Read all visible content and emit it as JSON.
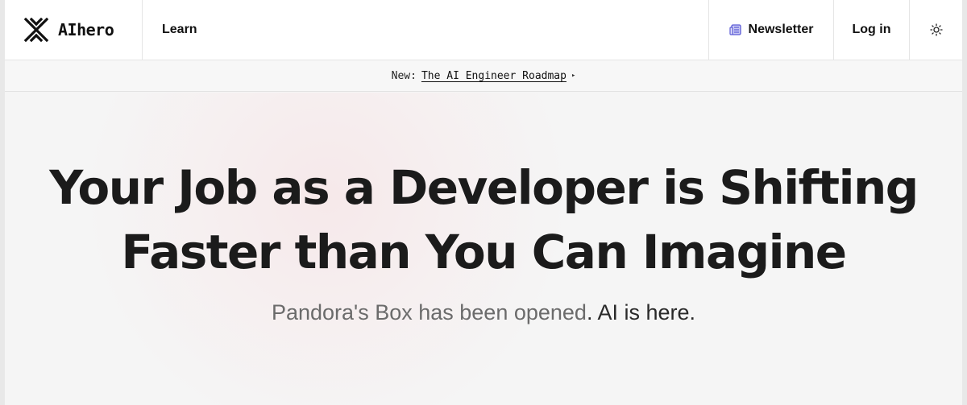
{
  "header": {
    "logo_text": "AIhero",
    "nav_learn": "Learn",
    "newsletter_label": "Newsletter",
    "login_label": "Log in"
  },
  "announcement": {
    "prefix": "New:",
    "link_text": "The AI Engineer Roadmap",
    "arrow": "▸"
  },
  "hero": {
    "title_line1": "Your Job as a Developer is Shifting",
    "title_line2": "Faster than You Can Imagine",
    "subtitle_muted": "Pandora's Box has been opened",
    "subtitle_dark": ". AI is here."
  },
  "colors": {
    "background": "#f5f5f5",
    "header_bg": "#ffffff",
    "text": "#1b1b1b",
    "muted_text": "#6b6b6b",
    "newsletter_icon": "#5b5bd6"
  },
  "icons": {
    "logo": "aihero-logo-icon",
    "newsletter": "newspaper-icon",
    "theme": "sun-icon"
  }
}
